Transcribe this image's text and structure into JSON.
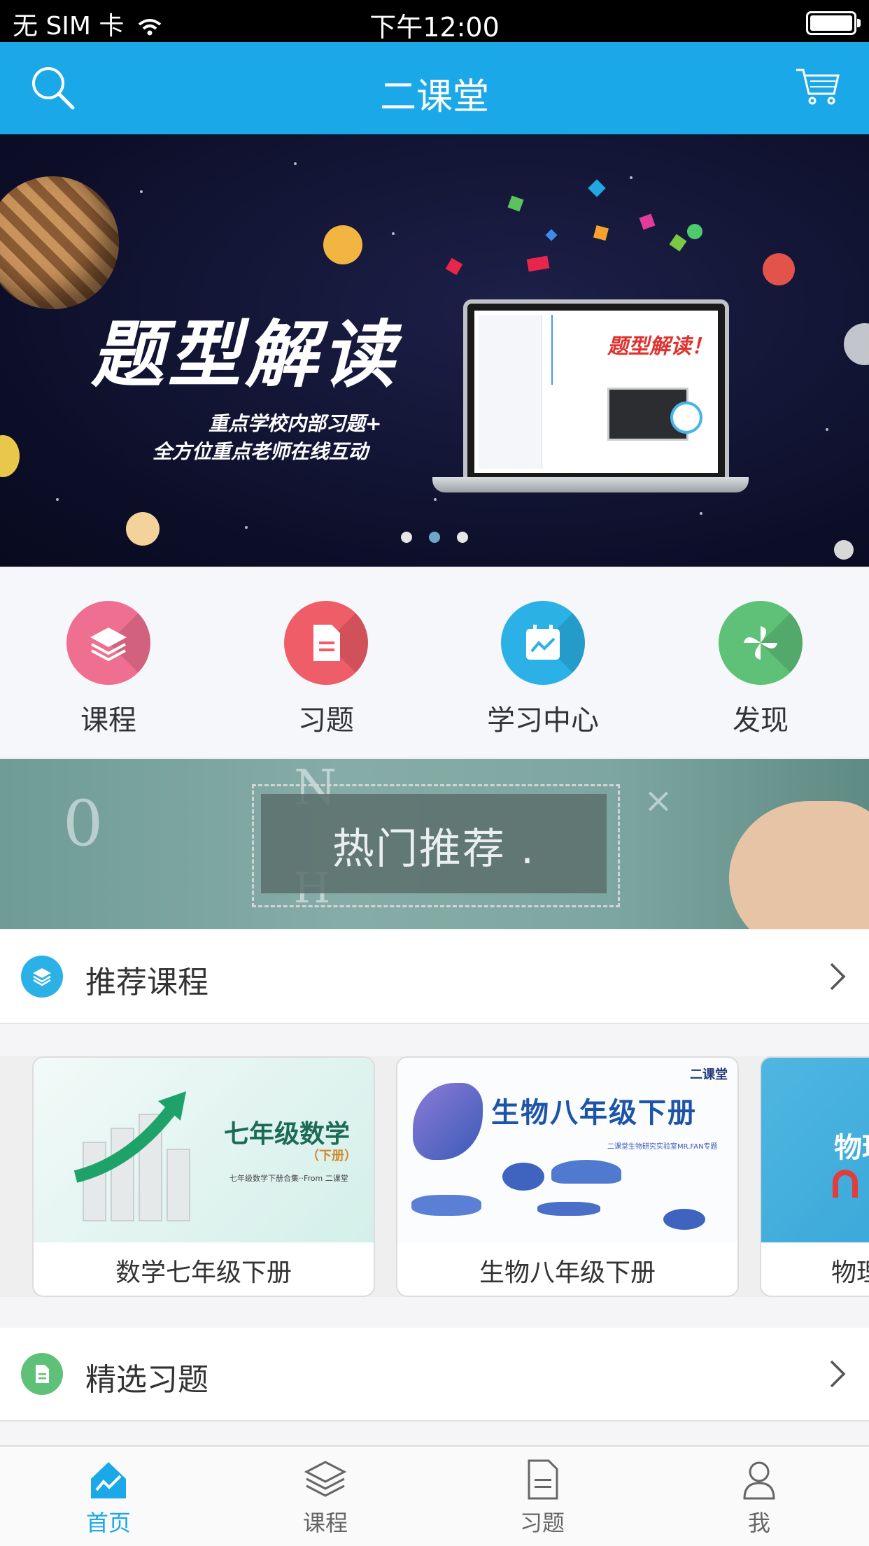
{
  "status_bar": {
    "carrier": "无 SIM 卡",
    "time": "下午12:00"
  },
  "nav": {
    "title": "二课堂",
    "search_icon": "search-icon",
    "cart_icon": "cart-icon"
  },
  "banner": {
    "headline": "题型解读",
    "line1": "重点学校内部习题+",
    "line2": "全方位重点老师在线互动",
    "laptop_caption": "题型解读！",
    "page_count": 3,
    "active_page": 2
  },
  "quick_menu": [
    {
      "label": "课程",
      "icon": "layers-icon",
      "color": "#ee6f8f"
    },
    {
      "label": "习题",
      "icon": "document-icon",
      "color": "#ee5d68"
    },
    {
      "label": "学习中心",
      "icon": "calendar-chart-icon",
      "color": "#2bb1e6"
    },
    {
      "label": "发现",
      "icon": "pinwheel-icon",
      "color": "#5fc178"
    }
  ],
  "hot_banner": {
    "text": "热门推荐 ."
  },
  "recommended_section": {
    "title": "推荐课程",
    "icon_color": "#2bb1e6"
  },
  "courses": [
    {
      "label": "数学七年级下册",
      "thumb_title": "七年级数学",
      "thumb_tag": "（下册）",
      "thumb_sub": "七年级数学下册合集··From 二课堂"
    },
    {
      "label": "生物八年级下册",
      "thumb_title": "生物八年级下册",
      "thumb_brand": "二课堂",
      "thumb_sub": "二课堂生物研究实验室MR.FAN专题"
    },
    {
      "label": "物理",
      "thumb_title": "物理"
    }
  ],
  "exercise_section": {
    "title": "精选习题",
    "icon_color": "#5fc178"
  },
  "tab_bar": [
    {
      "label": "首页",
      "icon": "home-chart-icon",
      "active": true
    },
    {
      "label": "课程",
      "icon": "layers-icon",
      "active": false
    },
    {
      "label": "习题",
      "icon": "document-icon",
      "active": false
    },
    {
      "label": "我",
      "icon": "user-icon",
      "active": false
    }
  ],
  "colors": {
    "primary": "#1aa8e8",
    "banner_bg": "#0d0f2a"
  }
}
